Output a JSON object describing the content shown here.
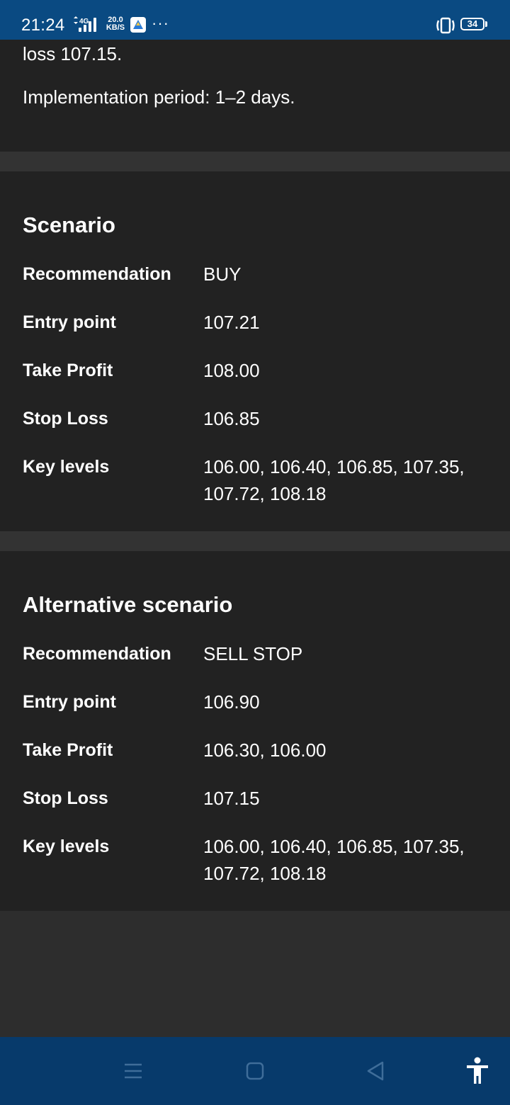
{
  "status_bar": {
    "time": "21:24",
    "network": "4G",
    "speed_value": "20.0",
    "speed_unit": "KB/S",
    "more": "···",
    "battery": "34"
  },
  "intro": {
    "line1": "loss 107.15.",
    "line2": "Implementation period: 1–2 days."
  },
  "scenario": {
    "title": "Scenario",
    "rows": [
      {
        "label": "Recommendation",
        "value": "BUY"
      },
      {
        "label": "Entry point",
        "value": "107.21"
      },
      {
        "label": "Take Profit",
        "value": "108.00"
      },
      {
        "label": "Stop Loss",
        "value": "106.85"
      },
      {
        "label": "Key levels",
        "value": "106.00, 106.40, 106.85, 107.35, 107.72, 108.18"
      }
    ]
  },
  "alternative": {
    "title": "Alternative scenario",
    "rows": [
      {
        "label": "Recommendation",
        "value": "SELL STOP"
      },
      {
        "label": "Entry point",
        "value": "106.90"
      },
      {
        "label": "Take Profit",
        "value": "106.30, 106.00"
      },
      {
        "label": "Stop Loss",
        "value": "107.15"
      },
      {
        "label": "Key levels",
        "value": "106.00, 106.40, 106.85, 107.35, 107.72, 108.18"
      }
    ]
  },
  "nav": {
    "icons": [
      "menu-icon",
      "home-icon",
      "back-icon",
      "accessibility-icon"
    ]
  },
  "colors": {
    "status_bar": "#0a4a82",
    "nav_bar": "#073a6b",
    "card": "#222222",
    "gap": "#333333",
    "text": "#ffffff"
  }
}
